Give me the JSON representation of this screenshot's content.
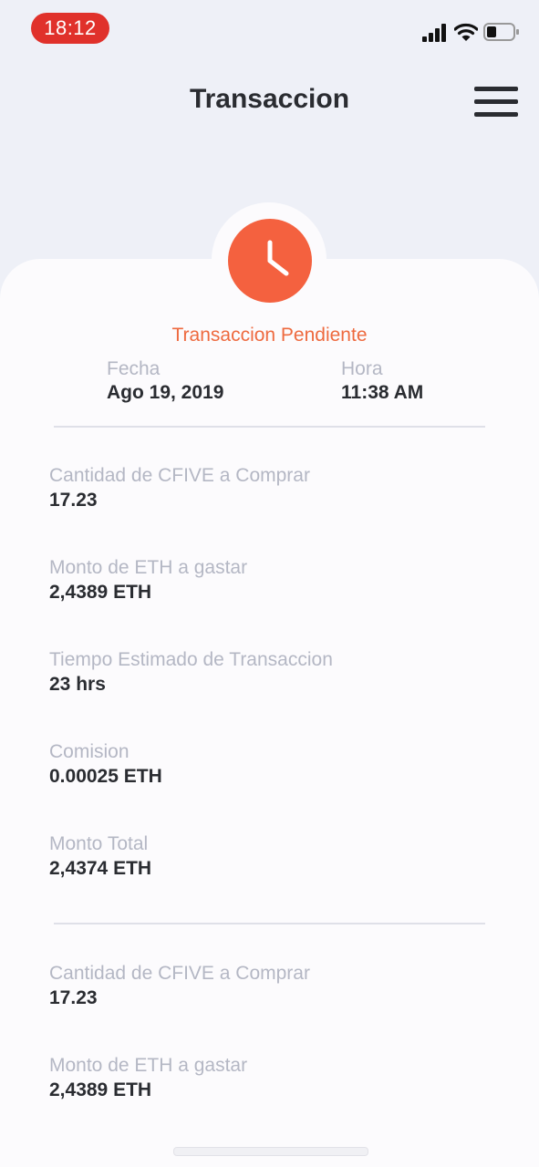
{
  "status_bar": {
    "time": "18:12",
    "time_pill_color": "#e0312b",
    "icons": [
      "signal-icon",
      "wifi-icon",
      "battery-icon"
    ]
  },
  "header": {
    "title": "Transaccion",
    "menu_icon": "hamburger-menu-icon"
  },
  "transaction": {
    "status_icon": "clock-icon",
    "status_color": "#ee6a3f",
    "status": "Transaccion Pendiente",
    "date_label": "Fecha",
    "date_value": "Ago 19, 2019",
    "time_label": "Hora",
    "time_value": "11:38 AM"
  },
  "details": [
    {
      "label": "Cantidad de CFIVE a Comprar",
      "value": "17.23"
    },
    {
      "label": "Monto de ETH a gastar",
      "value": "2,4389 ETH"
    },
    {
      "label": "Tiempo Estimado de Transaccion",
      "value": "23 hrs"
    },
    {
      "label": "Comision",
      "value": "0.00025 ETH"
    },
    {
      "label": "Monto Total",
      "value": "2,4374 ETH"
    }
  ],
  "details_second": [
    {
      "label": "Cantidad de CFIVE a Comprar",
      "value": "17.23"
    },
    {
      "label": "Monto de ETH a gastar",
      "value": "2,4389 ETH"
    }
  ]
}
